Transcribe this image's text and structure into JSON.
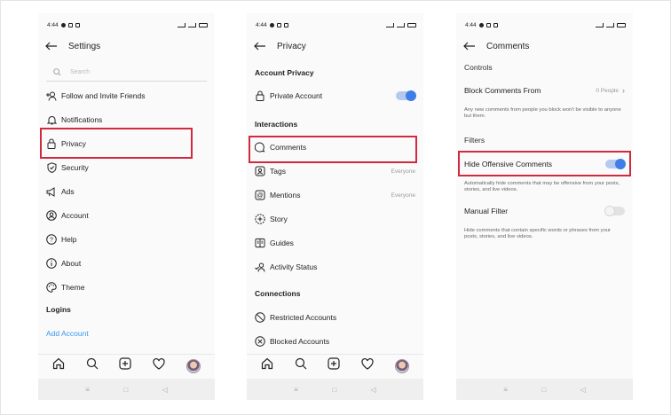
{
  "status_bar": {
    "time": "4:44"
  },
  "settings": {
    "title": "Settings",
    "search_placeholder": "Search",
    "items": [
      {
        "label": "Follow and Invite Friends",
        "icon": "add-person-icon"
      },
      {
        "label": "Notifications",
        "icon": "bell-icon"
      },
      {
        "label": "Privacy",
        "icon": "lock-icon"
      },
      {
        "label": "Security",
        "icon": "shield-icon"
      },
      {
        "label": "Ads",
        "icon": "megaphone-icon"
      },
      {
        "label": "Account",
        "icon": "account-circle-icon"
      },
      {
        "label": "Help",
        "icon": "help-icon"
      },
      {
        "label": "About",
        "icon": "info-icon"
      },
      {
        "label": "Theme",
        "icon": "palette-icon"
      }
    ],
    "logins_header": "Logins",
    "add_account": "Add Account"
  },
  "privacy": {
    "title": "Privacy",
    "account_privacy_header": "Account Privacy",
    "private_account": "Private Account",
    "private_account_on": true,
    "interactions_header": "Interactions",
    "comments": "Comments",
    "tags": "Tags",
    "tags_value": "Everyone",
    "mentions": "Mentions",
    "mentions_value": "Everyone",
    "story": "Story",
    "guides": "Guides",
    "activity_status": "Activity Status",
    "connections_header": "Connections",
    "restricted_accounts": "Restricted Accounts",
    "blocked_accounts": "Blocked Accounts"
  },
  "comments": {
    "title": "Comments",
    "controls_header": "Controls",
    "block_comments_from": "Block Comments From",
    "block_comments_value": "0 People",
    "block_note": "Any new comments from people you block won't be visible to anyone but them.",
    "filters_header": "Filters",
    "hide_offensive": "Hide Offensive Comments",
    "hide_offensive_on": true,
    "hide_offensive_note": "Automatically hide comments that may be offensive from your posts, stories, and live videos.",
    "manual_filter": "Manual Filter",
    "manual_filter_on": false,
    "manual_filter_note": "Hide comments that contain specific words or phrases from your posts, stories, and live videos."
  },
  "nav_glyphs": {
    "menu": "≡",
    "home": "□",
    "back": "◁"
  },
  "colors": {
    "highlight": "#d12a3e",
    "toggle_on": "#3e7ee6",
    "link": "#3897f0"
  }
}
